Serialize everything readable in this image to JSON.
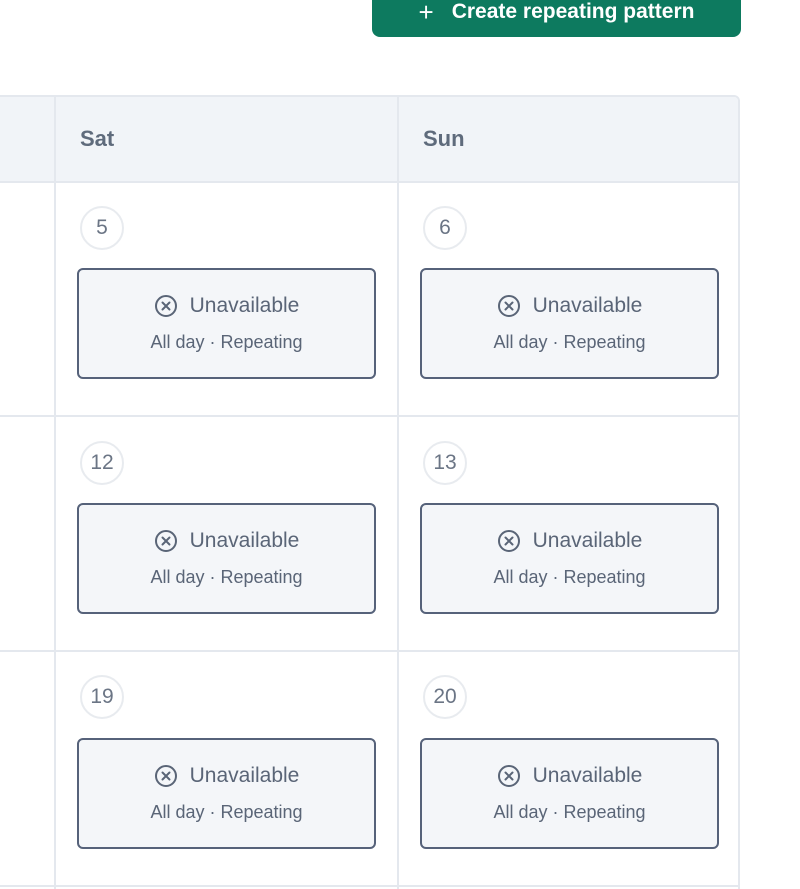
{
  "toolbar": {
    "create_label": "Create repeating pattern",
    "create_icon": "plus-icon"
  },
  "calendar": {
    "headers": [
      "Sat",
      "Sun"
    ],
    "weeks": [
      {
        "days": [
          {
            "number": "5",
            "slot": {
              "title": "Unavailable",
              "subtitle": "All day · Repeating",
              "icon": "x-circle-icon"
            }
          },
          {
            "number": "6",
            "slot": {
              "title": "Unavailable",
              "subtitle": "All day · Repeating",
              "icon": "x-circle-icon"
            }
          }
        ]
      },
      {
        "days": [
          {
            "number": "12",
            "slot": {
              "title": "Unavailable",
              "subtitle": "All day · Repeating",
              "icon": "x-circle-icon"
            }
          },
          {
            "number": "13",
            "slot": {
              "title": "Unavailable",
              "subtitle": "All day · Repeating",
              "icon": "x-circle-icon"
            }
          }
        ]
      },
      {
        "days": [
          {
            "number": "19",
            "slot": {
              "title": "Unavailable",
              "subtitle": "All day · Repeating",
              "icon": "x-circle-icon"
            }
          },
          {
            "number": "20",
            "slot": {
              "title": "Unavailable",
              "subtitle": "All day · Repeating",
              "icon": "x-circle-icon"
            }
          }
        ]
      }
    ]
  },
  "colors": {
    "brand": "#0d7a5f",
    "border": "#e4e8ee",
    "slot_border": "#56627a",
    "text_muted": "#5f6b7c"
  }
}
